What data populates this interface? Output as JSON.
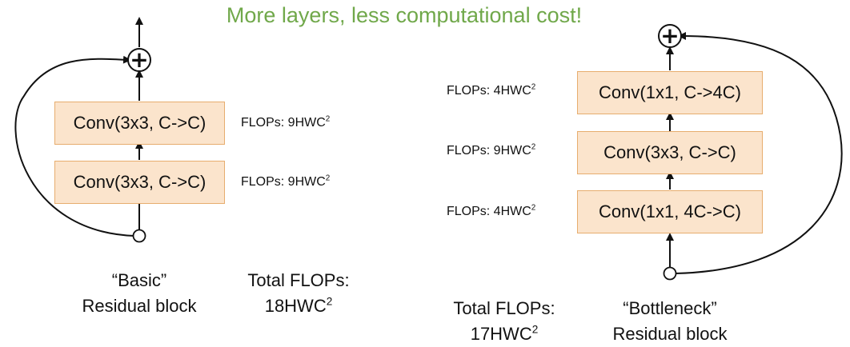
{
  "headline": "More layers, less computational cost!",
  "basic": {
    "blocks": [
      {
        "label": "Conv(3x3, C->C)",
        "flops_prefix": "FLOPs: 9HWC",
        "flops_exp": "2"
      },
      {
        "label": "Conv(3x3, C->C)",
        "flops_prefix": "FLOPs: 9HWC",
        "flops_exp": "2"
      }
    ],
    "caption_line1": "“Basic”",
    "caption_line2": "Residual block",
    "total_line1": "Total FLOPs:",
    "total_prefix": "18HWC",
    "total_exp": "2"
  },
  "bottleneck": {
    "blocks": [
      {
        "label": "Conv(1x1, C->4C)",
        "flops_prefix": "FLOPs: 4HWC",
        "flops_exp": "2"
      },
      {
        "label": "Conv(3x3, C->C)",
        "flops_prefix": "FLOPs: 9HWC",
        "flops_exp": "2"
      },
      {
        "label": "Conv(1x1, 4C->C)",
        "flops_prefix": "FLOPs: 4HWC",
        "flops_exp": "2"
      }
    ],
    "caption_line1": "“Bottleneck”",
    "caption_line2": "Residual block",
    "total_line1": "Total FLOPs:",
    "total_prefix": "17HWC",
    "total_exp": "2"
  },
  "symbols": {
    "add": "+"
  },
  "colors": {
    "headline": "#70a84a",
    "block_fill": "#fbe4cc",
    "block_border": "#e7ad6e",
    "line": "#111111"
  }
}
